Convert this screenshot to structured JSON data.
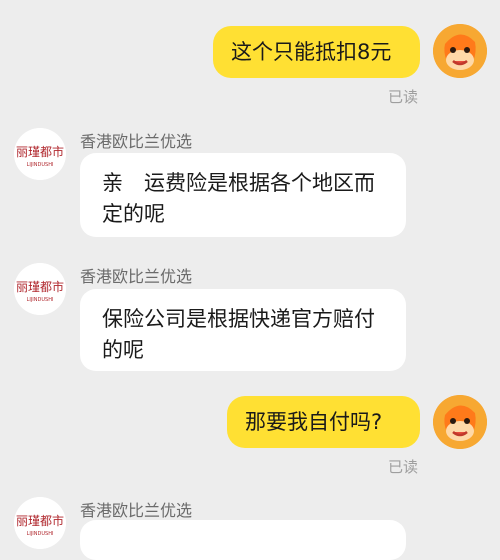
{
  "messages": [
    {
      "side": "me",
      "text": "这个只能抵扣8元",
      "status": "已读"
    },
    {
      "side": "them",
      "sender": "香港欧比兰优选",
      "text": "亲　运费险是根据各个地区而定的呢"
    },
    {
      "side": "them",
      "sender": "香港欧比兰优选",
      "text": "保险公司是根据快递官方赔付的呢"
    },
    {
      "side": "me",
      "text": "那要我自付吗?",
      "status": "已读"
    },
    {
      "side": "them",
      "sender": "香港欧比兰优选",
      "text": ""
    }
  ],
  "shop_logo": {
    "line1": "丽瑾都市",
    "line2": "LIJINDUSHI",
    "color": "#b0272d"
  },
  "colors": {
    "my_bubble": "#ffe033",
    "their_bubble": "#ffffff",
    "background": "#ededed",
    "my_avatar": "#f7a832"
  }
}
